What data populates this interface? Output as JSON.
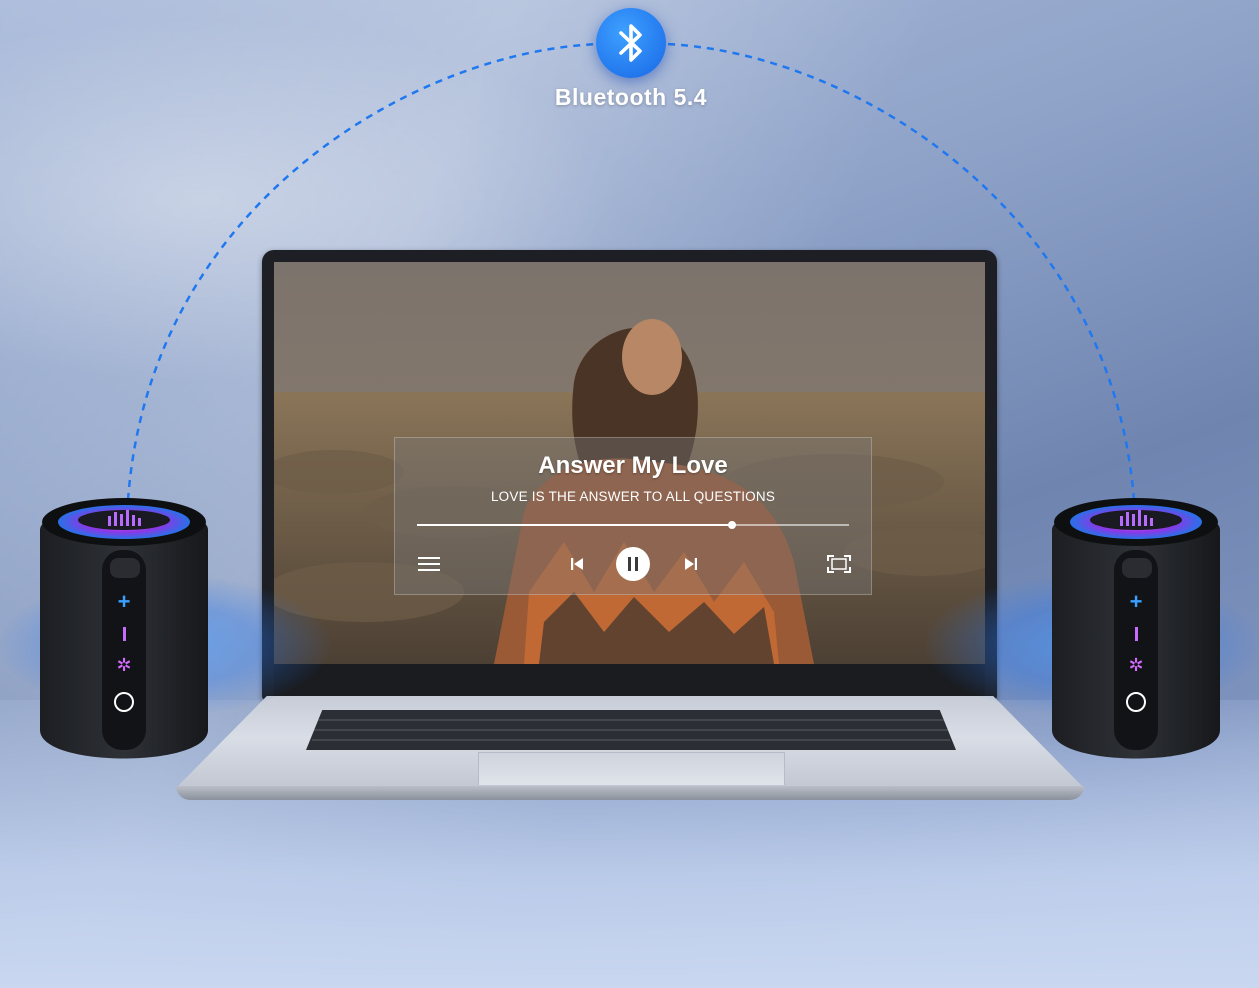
{
  "connection": {
    "label": "Bluetooth 5.4",
    "icon": "bluetooth-icon",
    "accent": "#1f78f0"
  },
  "player": {
    "title": "Answer My Love",
    "subtitle": "LOVE IS THE ANSWER TO ALL QUESTIONS",
    "progress": 0.73,
    "state": "playing",
    "controls": {
      "menu_icon": "menu-icon",
      "prev_icon": "skip-previous-icon",
      "pause_icon": "pause-icon",
      "next_icon": "skip-next-icon",
      "fullscreen_icon": "fullscreen-icon"
    }
  },
  "speakers": {
    "buttons": [
      "volume-up",
      "volume-down",
      "light-mode",
      "power"
    ],
    "glow_colors": [
      "#c040ff",
      "#3aa0ff"
    ]
  }
}
